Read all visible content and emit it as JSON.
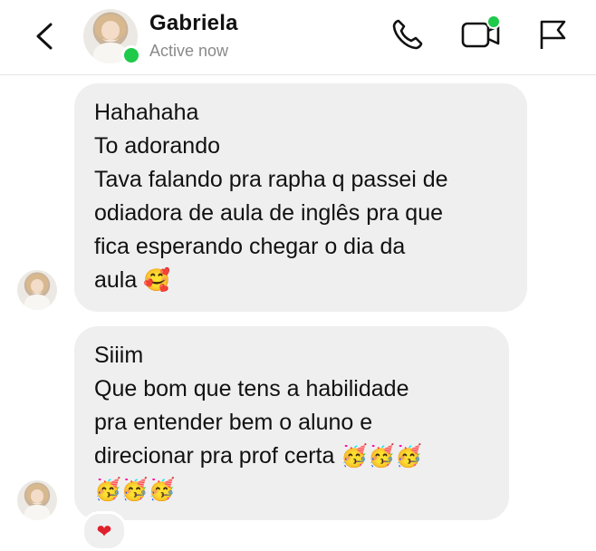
{
  "header": {
    "contact_name": "Gabriela",
    "status": "Active now",
    "icons": [
      "back-icon",
      "phone-icon",
      "video-icon",
      "flag-icon"
    ],
    "online_color": "#1fc94a"
  },
  "messages": [
    {
      "sender": "Gabriela",
      "lines": [
        "Hahahaha",
        "To adorando",
        "Tava falando pra rapha q passei de",
        "odiadora de aula de inglês pra que",
        "fica esperando chegar o dia da",
        "aula"
      ],
      "emoji": "🥰"
    },
    {
      "sender": "Gabriela",
      "lines": [
        "Siiim",
        "Que bom que tens a habilidade",
        "pra entender bem o aluno e",
        "direcionar pra prof certa"
      ],
      "emoji_inline": "🥳🥳🥳",
      "emoji_line": "🥳🥳🥳",
      "reaction": "❤"
    }
  ],
  "colors": {
    "bubble": "#efefef",
    "text": "#111111",
    "muted": "#8a8a8a"
  }
}
